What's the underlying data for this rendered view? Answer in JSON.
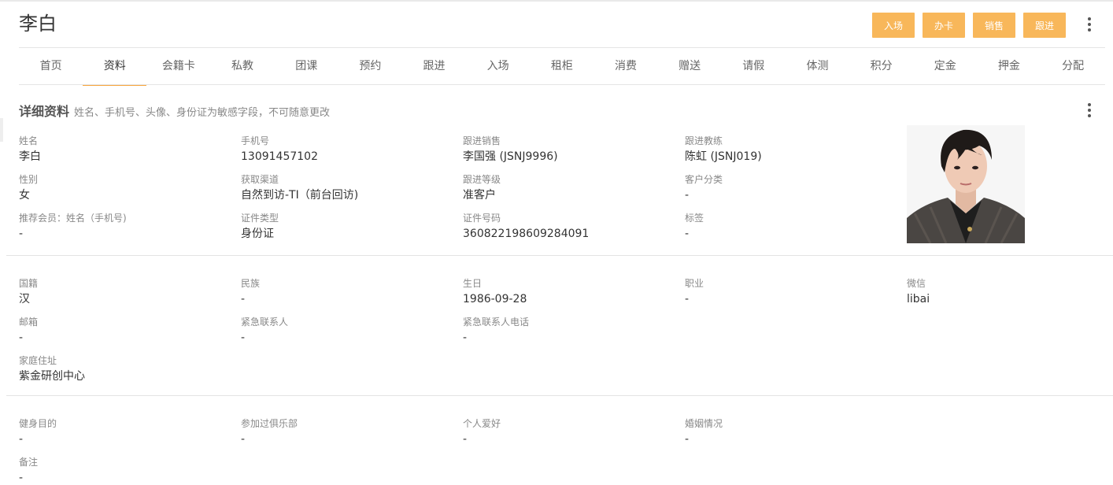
{
  "header": {
    "name": "李白",
    "actions": [
      "入场",
      "办卡",
      "销售",
      "跟进"
    ]
  },
  "tabs": [
    "首页",
    "资料",
    "会籍卡",
    "私教",
    "团课",
    "预约",
    "跟进",
    "入场",
    "租柜",
    "消费",
    "赠送",
    "请假",
    "体测",
    "积分",
    "定金",
    "押金",
    "分配"
  ],
  "active_tab": "资料",
  "section": {
    "title": "详细资料",
    "subtitle": "姓名、手机号、头像、身份证为敏感字段，不可随意更改"
  },
  "basic": {
    "name": {
      "label": "姓名",
      "value": "李白"
    },
    "phone": {
      "label": "手机号",
      "value": "13091457102"
    },
    "sales": {
      "label": "跟进销售",
      "value": "李国强 (JSNJ9996)"
    },
    "coach": {
      "label": "跟进教练",
      "value": "陈虹 (JSNJ019)"
    },
    "gender": {
      "label": "性别",
      "value": "女"
    },
    "channel": {
      "label": "获取渠道",
      "value": "自然到访-TI（前台回访)"
    },
    "level": {
      "label": "跟进等级",
      "value": "准客户"
    },
    "category": {
      "label": "客户分类",
      "value": "-"
    },
    "referrer": {
      "label": "推荐会员：姓名（手机号)",
      "value": "-"
    },
    "id_type": {
      "label": "证件类型",
      "value": "身份证"
    },
    "id_number": {
      "label": "证件号码",
      "value": "360822198609284091"
    },
    "tags": {
      "label": "标签",
      "value": "-"
    }
  },
  "personal": {
    "nationality": {
      "label": "国籍",
      "value": "汉"
    },
    "ethnicity": {
      "label": "民族",
      "value": "-"
    },
    "birthday": {
      "label": "生日",
      "value": "1986-09-28"
    },
    "occupation": {
      "label": "职业",
      "value": "-"
    },
    "wechat": {
      "label": "微信",
      "value": "libai"
    },
    "email": {
      "label": "邮箱",
      "value": "-"
    },
    "emergency_contact": {
      "label": "紧急联系人",
      "value": "-"
    },
    "emergency_phone": {
      "label": "紧急联系人电话",
      "value": "-"
    },
    "address": {
      "label": "家庭住址",
      "value": "紫金研创中心"
    }
  },
  "extra": {
    "fitness_goal": {
      "label": "健身目的",
      "value": "-"
    },
    "clubs": {
      "label": "参加过俱乐部",
      "value": "-"
    },
    "hobbies": {
      "label": "个人爱好",
      "value": "-"
    },
    "marital": {
      "label": "婚姻情况",
      "value": "-"
    },
    "remark": {
      "label": "备注",
      "value": "-"
    }
  },
  "colors": {
    "accent": "#f8b75a",
    "tab_underline": "#f8a43b"
  }
}
